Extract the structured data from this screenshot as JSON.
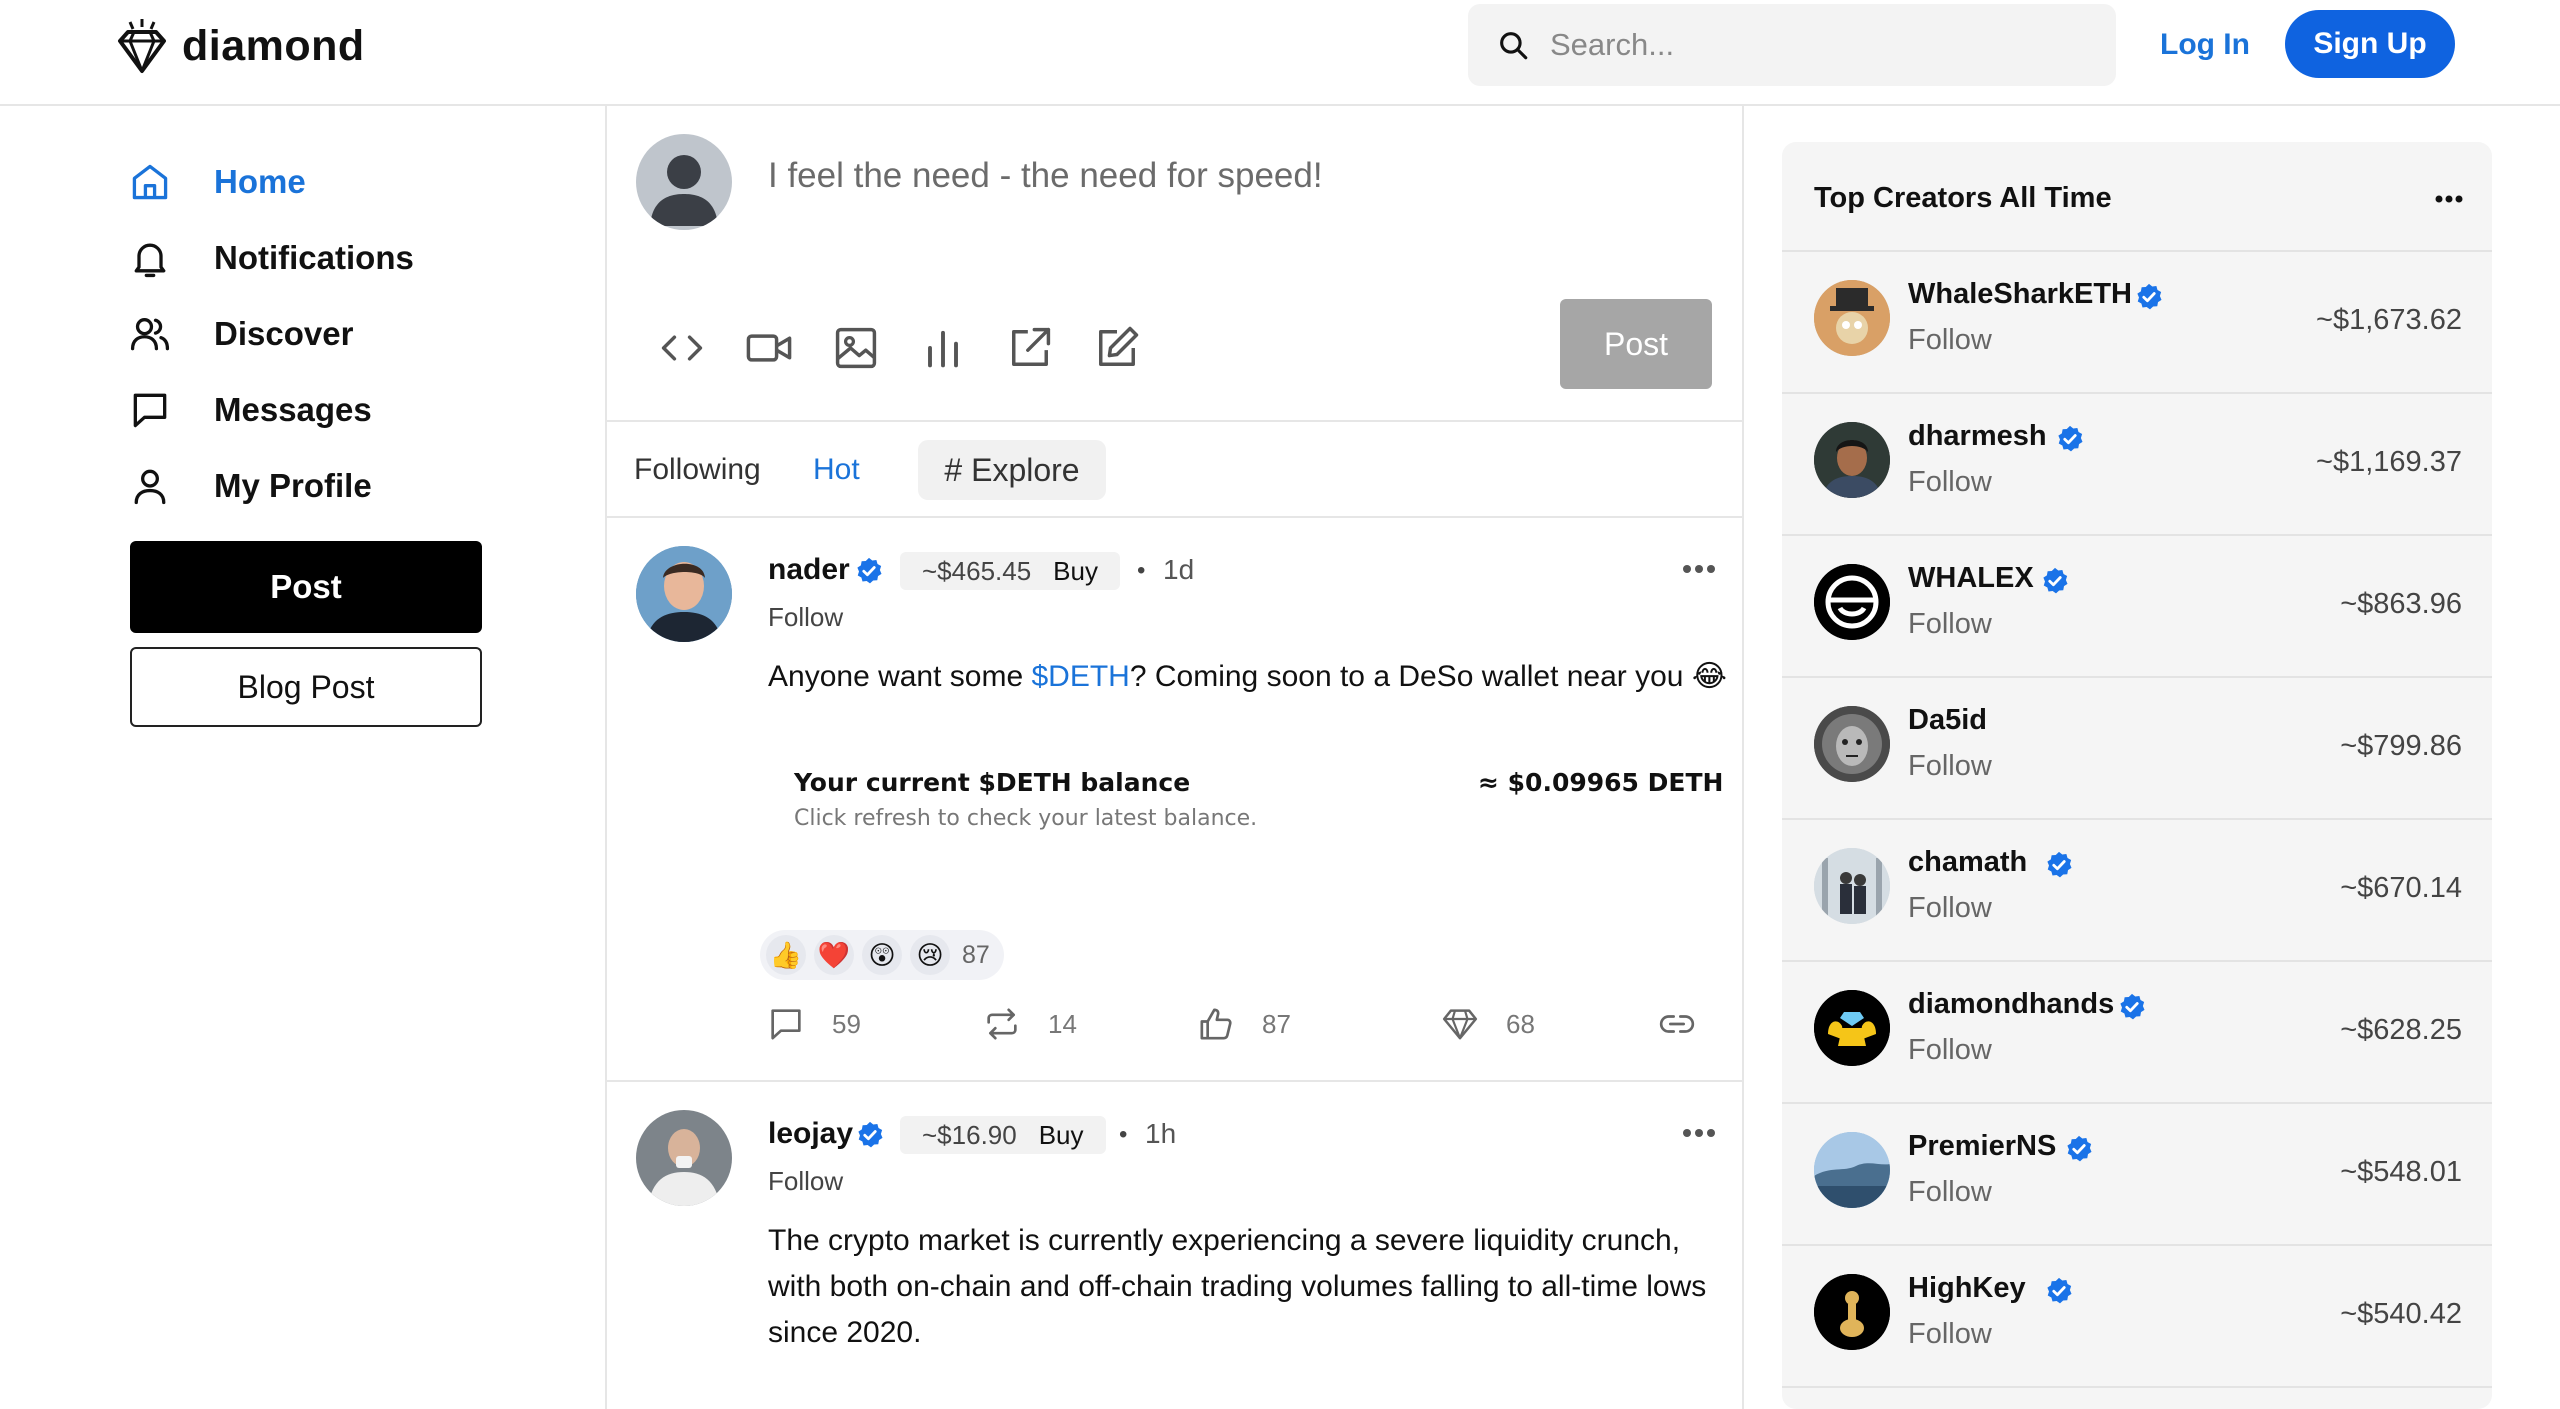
{
  "app": {
    "logo_text": "diamond",
    "search_placeholder": "Search...",
    "login_label": "Log In",
    "signup_label": "Sign Up",
    "accent_color": "#1a73d9"
  },
  "nav": {
    "items": [
      {
        "label": "Home",
        "icon": "home-icon"
      },
      {
        "label": "Notifications",
        "icon": "bell-icon"
      },
      {
        "label": "Discover",
        "icon": "people-icon"
      },
      {
        "label": "Messages",
        "icon": "message-icon"
      },
      {
        "label": "My Profile",
        "icon": "user-icon"
      }
    ],
    "post_label": "Post",
    "blog_label": "Blog Post"
  },
  "composer": {
    "placeholder": "I feel the need - the need for speed!",
    "post_label": "Post",
    "tools": [
      "code-icon",
      "video-icon",
      "image-icon",
      "poll-icon",
      "external-link-icon",
      "edit-icon"
    ]
  },
  "feed_tabs": [
    "Following",
    "Hot",
    "# Explore"
  ],
  "posts": [
    {
      "username": "nader",
      "coin_price": "~$465.45",
      "buy_label": "Buy",
      "time": "1d",
      "follow_label": "Follow",
      "body_before": "Anyone want some ",
      "body_tag": "$DETH",
      "body_after": "? Coming soon to a DeSo wallet near you 😂",
      "balance_title": "Your current $DETH balance",
      "balance_value": "≈ $0.09965 DETH",
      "balance_sub": "Click refresh to check your latest balance.",
      "reactions": [
        "👍",
        "❤️",
        "😲",
        "😢"
      ],
      "reaction_count": "87",
      "comments": "59",
      "reposts": "14",
      "likes": "87",
      "diamonds": "68"
    },
    {
      "username": "leojay",
      "coin_price": "~$16.90",
      "buy_label": "Buy",
      "time": "1h",
      "follow_label": "Follow",
      "body_line1": "The crypto market is currently experiencing a severe liquidity crunch,",
      "body_line2": "with both on-chain and off-chain trading volumes falling to all-time lows",
      "body_line3": "since 2020."
    }
  ],
  "top_creators": {
    "title": "Top Creators All Time",
    "follow_label": "Follow",
    "items": [
      {
        "name": "WhaleSharkETH",
        "verified": true,
        "value": "~$1,673.62"
      },
      {
        "name": "dharmesh",
        "verified": true,
        "value": "~$1,169.37"
      },
      {
        "name": "WHALEX",
        "verified": true,
        "value": "~$863.96"
      },
      {
        "name": "Da5id",
        "verified": false,
        "value": "~$799.86"
      },
      {
        "name": "chamath",
        "verified": true,
        "value": "~$670.14"
      },
      {
        "name": "diamondhands",
        "verified": true,
        "value": "~$628.25"
      },
      {
        "name": "PremierNS",
        "verified": true,
        "value": "~$548.01"
      },
      {
        "name": "HighKey",
        "verified": true,
        "value": "~$540.42"
      }
    ]
  }
}
